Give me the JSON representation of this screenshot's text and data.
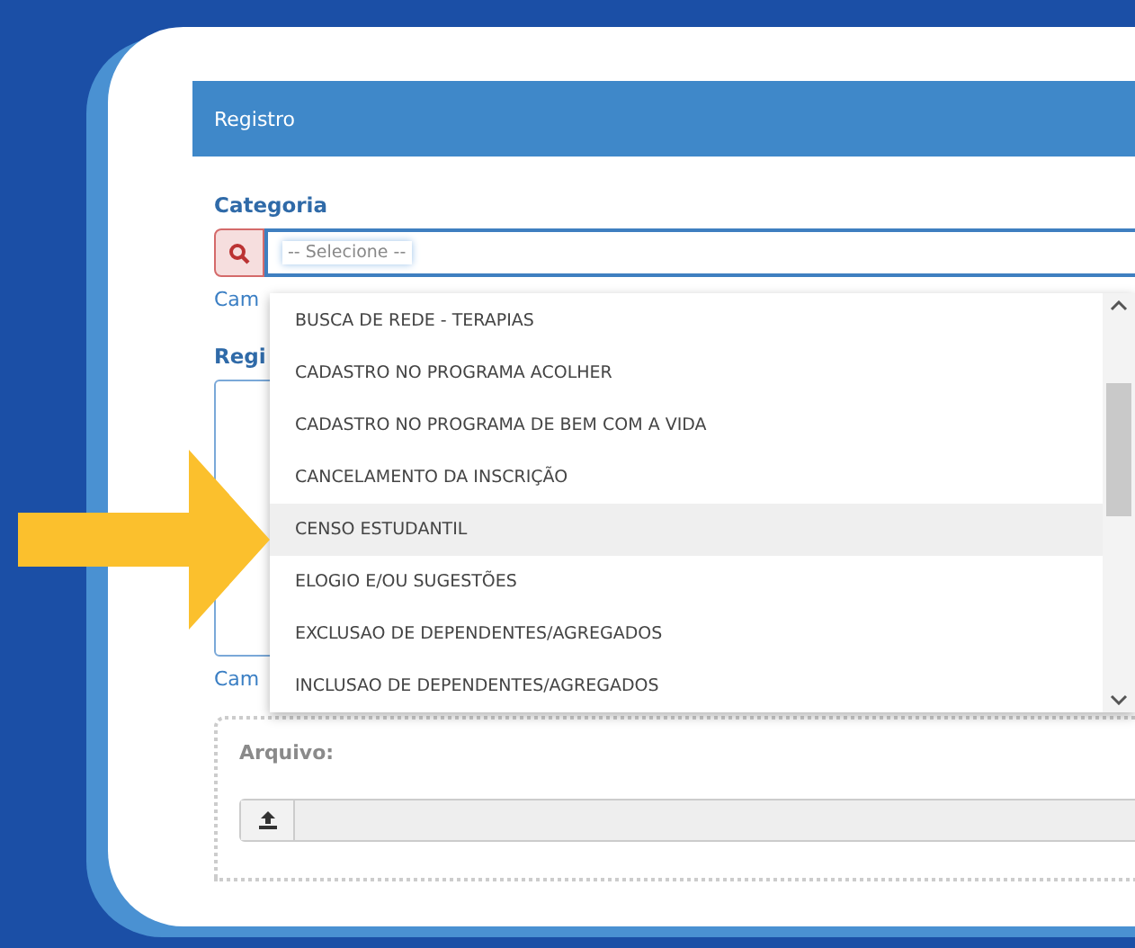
{
  "panel": {
    "title": "Registro"
  },
  "category": {
    "label": "Categoria",
    "value": "-- Selecione --",
    "hint": "Cam"
  },
  "record": {
    "label": "Regi",
    "hint": "Cam"
  },
  "dropdown": {
    "items": [
      {
        "label": "BUSCA DE REDE - TERAPIAS",
        "selected": false
      },
      {
        "label": "CADASTRO NO PROGRAMA ACOLHER",
        "selected": false
      },
      {
        "label": "CADASTRO NO PROGRAMA DE BEM COM A VIDA",
        "selected": false
      },
      {
        "label": "CANCELAMENTO DA INSCRIÇÃO",
        "selected": false
      },
      {
        "label": "CENSO ESTUDANTIL",
        "selected": true
      },
      {
        "label": "ELOGIO E/OU SUGESTÕES",
        "selected": false
      },
      {
        "label": "EXCLUSAO DE DEPENDENTES/AGREGADOS",
        "selected": false
      },
      {
        "label": "INCLUSAO DE DEPENDENTES/AGREGADOS",
        "selected": false
      }
    ]
  },
  "attachment": {
    "label": "Arquivo:"
  }
}
